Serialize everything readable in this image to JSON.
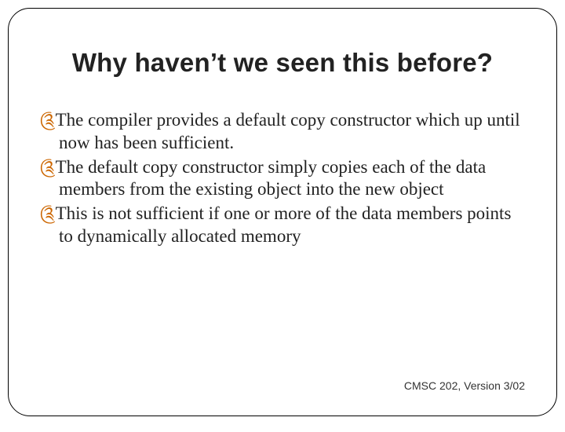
{
  "title": "Why haven’t we seen this before?",
  "bullets": [
    "The compiler provides a default copy constructor which up until now has been sufficient.",
    "The default copy constructor simply copies each of the data members from the existing object into the new object",
    "This is not sufficient if one or more of the data members points to dynamically allocated memory"
  ],
  "bullet_glyph": "༊",
  "footer": "CMSC 202, Version 3/02"
}
